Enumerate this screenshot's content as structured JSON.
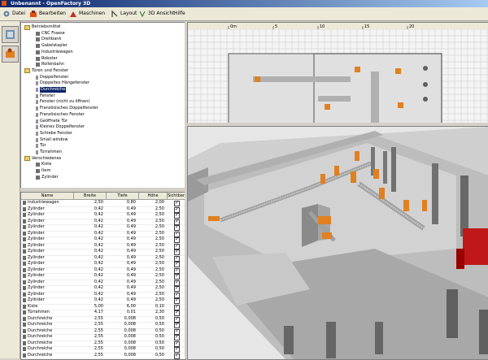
{
  "window": {
    "title": "Unbenannt - OpenFactory 3D"
  },
  "menubar": {
    "items": [
      {
        "label": "Datei",
        "icon": "gear-icon"
      },
      {
        "label": "Bearbeiten",
        "icon": "robot-icon"
      },
      {
        "label": "Maschinen",
        "icon": "machine-icon"
      },
      {
        "label": "Layout",
        "icon": "layout-icon"
      },
      {
        "label": "3D Ansicht",
        "icon": "3d-icon"
      },
      {
        "label": "Hilfe",
        "icon": ""
      }
    ]
  },
  "tree": {
    "items": [
      {
        "label": "Betriebsmittel",
        "level": 0,
        "type": "folder"
      },
      {
        "label": "CNC Fraese",
        "level": 1,
        "type": "item"
      },
      {
        "label": "Drehbank",
        "level": 1,
        "type": "item"
      },
      {
        "label": "Gabelstapler",
        "level": 1,
        "type": "item"
      },
      {
        "label": "Industriewagen",
        "level": 1,
        "type": "item"
      },
      {
        "label": "Roboter",
        "level": 1,
        "type": "item"
      },
      {
        "label": "Rollenbahn",
        "level": 1,
        "type": "item"
      },
      {
        "label": "Türen und Fenster",
        "level": 0,
        "type": "folder"
      },
      {
        "label": "Doppelfenster",
        "level": 1,
        "type": "window"
      },
      {
        "label": "Doppeltes Hängefenster",
        "level": 1,
        "type": "window"
      },
      {
        "label": "Durchreiche",
        "level": 1,
        "type": "window",
        "selected": true
      },
      {
        "label": "Fenster",
        "level": 1,
        "type": "window"
      },
      {
        "label": "Fenster (nicht zu öffnen)",
        "level": 1,
        "type": "window"
      },
      {
        "label": "Französisches Doppelfenster",
        "level": 1,
        "type": "window"
      },
      {
        "label": "Französisches Fenster",
        "level": 1,
        "type": "window"
      },
      {
        "label": "Geöffnete Tür",
        "level": 1,
        "type": "window"
      },
      {
        "label": "Kleines Doppelfenster",
        "level": 1,
        "type": "window"
      },
      {
        "label": "Schiebe Fenster",
        "level": 1,
        "type": "window"
      },
      {
        "label": "Small window",
        "level": 1,
        "type": "window"
      },
      {
        "label": "Tür",
        "level": 1,
        "type": "window"
      },
      {
        "label": "Türrahmen",
        "level": 1,
        "type": "window"
      },
      {
        "label": "Verschiedenes",
        "level": 0,
        "type": "folder"
      },
      {
        "label": "Kiste",
        "level": 1,
        "type": "item"
      },
      {
        "label": "Item",
        "level": 1,
        "type": "item"
      },
      {
        "label": "Zylinder",
        "level": 1,
        "type": "item"
      }
    ]
  },
  "table": {
    "columns": [
      "Name",
      "Breite",
      "Tiefe",
      "Höhe",
      "Sichtbar"
    ],
    "rows": [
      [
        "Industriewagen",
        "2,50",
        "0,80",
        "2,00"
      ],
      [
        "Zylinder",
        "0,42",
        "0,49",
        "2,50"
      ],
      [
        "Zylinder",
        "0,42",
        "0,49",
        "2,50"
      ],
      [
        "Zylinder",
        "0,42",
        "0,49",
        "2,50"
      ],
      [
        "Zylinder",
        "0,42",
        "0,49",
        "2,50"
      ],
      [
        "Zylinder",
        "0,42",
        "0,49",
        "2,50"
      ],
      [
        "Zylinder",
        "0,42",
        "0,49",
        "2,50"
      ],
      [
        "Zylinder",
        "0,42",
        "0,49",
        "2,50"
      ],
      [
        "Zylinder",
        "0,42",
        "0,49",
        "2,50"
      ],
      [
        "Zylinder",
        "0,42",
        "0,49",
        "2,50"
      ],
      [
        "Zylinder",
        "0,42",
        "0,49",
        "2,50"
      ],
      [
        "Zylinder",
        "0,42",
        "0,49",
        "2,50"
      ],
      [
        "Zylinder",
        "0,42",
        "0,49",
        "2,50"
      ],
      [
        "Zylinder",
        "0,42",
        "0,49",
        "2,50"
      ],
      [
        "Zylinder",
        "0,42",
        "0,49",
        "2,50"
      ],
      [
        "Zylinder",
        "0,42",
        "0,49",
        "2,50"
      ],
      [
        "Zylinder",
        "0,42",
        "0,49",
        "2,50"
      ],
      [
        "Kiste",
        "5,00",
        "6,00",
        "0,10"
      ],
      [
        "Türrahmen",
        "4,17",
        "0,01",
        "2,30"
      ],
      [
        "Durchreiche",
        "2,55",
        "0,008",
        "0,50"
      ],
      [
        "Durchreiche",
        "2,55",
        "0,008",
        "0,50"
      ],
      [
        "Durchreiche",
        "2,55",
        "0,008",
        "0,50"
      ],
      [
        "Durchreiche",
        "2,55",
        "0,008",
        "0,50"
      ],
      [
        "Durchreiche",
        "2,55",
        "0,008",
        "0,50"
      ],
      [
        "Durchreiche",
        "2,55",
        "0,008",
        "0,50"
      ],
      [
        "Durchreiche",
        "2,55",
        "0,008",
        "0,50"
      ]
    ]
  },
  "topview": {
    "ruler_labels": [
      "0m",
      "5",
      "10",
      "15",
      "20"
    ]
  },
  "colors": {
    "accent": "#0a246a",
    "floor": "#d8d8d8",
    "robot": "#e08020",
    "pillar": "#707070"
  }
}
